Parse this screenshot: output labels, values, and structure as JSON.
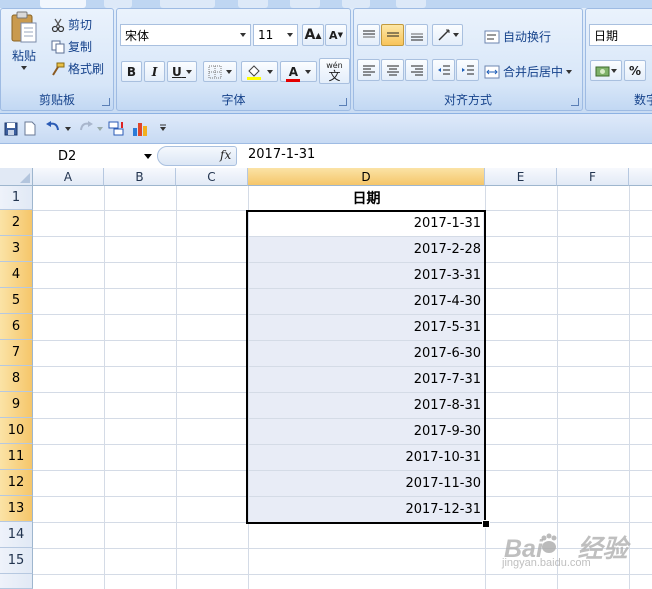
{
  "clipboard": {
    "paste_label": "粘贴",
    "cut_label": "剪切",
    "copy_label": "复制",
    "format_painter_label": "格式刷",
    "group_label": "剪贴板"
  },
  "font": {
    "name": "宋体",
    "size": "11",
    "grow_label": "A",
    "shrink_label": "A",
    "bold_label": "B",
    "italic_label": "I",
    "underline_label": "U",
    "font_color_label": "A",
    "phonetic_label": "文",
    "phonetic_top": "wén",
    "group_label": "字体"
  },
  "alignment": {
    "wrap_label": "自动换行",
    "merge_label": "合并后居中",
    "group_label": "对齐方式"
  },
  "number": {
    "format": "日期",
    "percent_label": "%",
    "group_label": "数字"
  },
  "formula_bar": {
    "name_box": "D2",
    "fx_label": "fx",
    "value": "2017-1-31"
  },
  "grid": {
    "columns": [
      "A",
      "B",
      "C",
      "D",
      "E",
      "F"
    ],
    "rows": [
      "1",
      "2",
      "3",
      "4",
      "5",
      "6",
      "7",
      "8",
      "9",
      "10",
      "11",
      "12",
      "13",
      "14",
      "15"
    ],
    "header_cell": "日期",
    "dates": [
      "2017-1-31",
      "2017-2-28",
      "2017-3-31",
      "2017-4-30",
      "2017-5-31",
      "2017-6-30",
      "2017-7-31",
      "2017-8-31",
      "2017-9-30",
      "2017-10-31",
      "2017-11-30",
      "2017-12-31"
    ]
  },
  "colors": {
    "selection_fill": "#e8ecf6",
    "header_highlight": "#f5c66a",
    "ribbon_text": "#15428b"
  }
}
